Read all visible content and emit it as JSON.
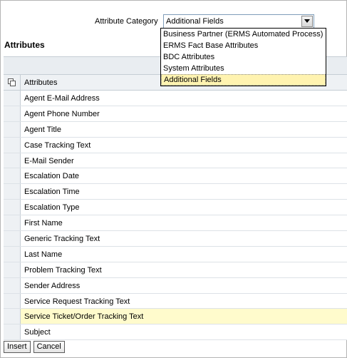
{
  "header": {
    "category_label": "Attribute Category",
    "category_value": "Additional Fields",
    "section_title": "Attributes"
  },
  "dropdown": {
    "options": [
      "Business Partner (ERMS Automated Process)",
      "ERMS Fact Base Attributes",
      "BDC Attributes",
      "System Attributes",
      "Additional Fields"
    ],
    "selected_index": 4
  },
  "grid": {
    "column_header": "Attributes",
    "rows": [
      "Agent E-Mail Address",
      "Agent Phone Number",
      "Agent Title",
      "Case Tracking Text",
      "E-Mail Sender",
      "Escalation Date",
      "Escalation Time",
      "Escalation Type",
      "First Name",
      "Generic Tracking Text",
      "Last Name",
      "Problem Tracking Text",
      "Sender Address",
      "Service Request Tracking Text",
      "Service Ticket/Order Tracking Text",
      "Subject"
    ],
    "highlighted_row": "Service Ticket/Order Tracking Text"
  },
  "buttons": {
    "insert_label": "Insert",
    "cancel_label": "Cancel"
  },
  "colors": {
    "highlight_row": "#fffbcc",
    "selected_option": "#fff3b0",
    "header_bg": "#eef1f4"
  }
}
